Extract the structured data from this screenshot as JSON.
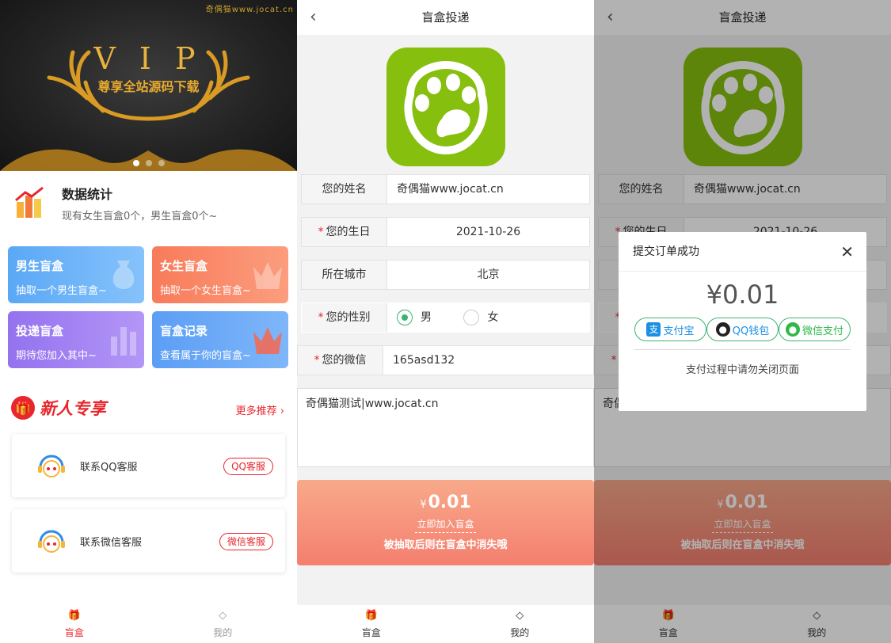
{
  "home": {
    "banner": {
      "watermark": "奇偶猫www.jocat.cn",
      "vip_text": "VIP",
      "vip_subtitle": "尊享全站源码下载"
    },
    "stats": {
      "title": "数据统计",
      "subtitle": "现有女生盲盒0个，男生盲盒0个~"
    },
    "cards": [
      {
        "title": "男生盲盒",
        "subtitle": "抽取一个男生盲盒~"
      },
      {
        "title": "女生盲盒",
        "subtitle": "抽取一个女生盲盒~"
      },
      {
        "title": "投递盲盒",
        "subtitle": "期待您加入其中~"
      },
      {
        "title": "盲盒记录",
        "subtitle": "查看属于你的盲盒~"
      }
    ],
    "promo": {
      "title": "新人专享",
      "more": "更多推荐",
      "services": [
        {
          "label": "联系QQ客服",
          "button": "QQ客服"
        },
        {
          "label": "联系微信客服",
          "button": "微信客服"
        }
      ]
    }
  },
  "form": {
    "header_title": "盲盒投递",
    "fields": {
      "name_label": "您的姓名",
      "name_value": "奇偶猫www.jocat.cn",
      "birthday_label": "您的生日",
      "birthday_value": "2021-10-26",
      "city_label": "所在城市",
      "city_value": "北京",
      "gender_label": "您的性别",
      "gender_male": "男",
      "gender_female": "女",
      "wechat_label": "您的微信",
      "wechat_value": "165asd132",
      "required_mark": "*"
    },
    "message": "奇偶猫测试|www.jocat.cn",
    "pay": {
      "currency": "¥",
      "price": "0.01",
      "join": "立即加入盲盒",
      "note": "被抽取后则在盲盒中消失哦"
    }
  },
  "dialog": {
    "title": "提交订单成功",
    "amount": "¥0.01",
    "alipay": "支付宝",
    "qq": "QQ钱包",
    "wechat": "微信支付",
    "tip": "支付过程中请勿关闭页面"
  },
  "tabbar": {
    "box": "盲盒",
    "mine": "我的"
  },
  "colors": {
    "brand_red": "#e8262b",
    "logo_green": "#86bf0e",
    "pay_gradient_top": "#f8a98a",
    "pay_gradient_bottom": "#f47f6f"
  }
}
